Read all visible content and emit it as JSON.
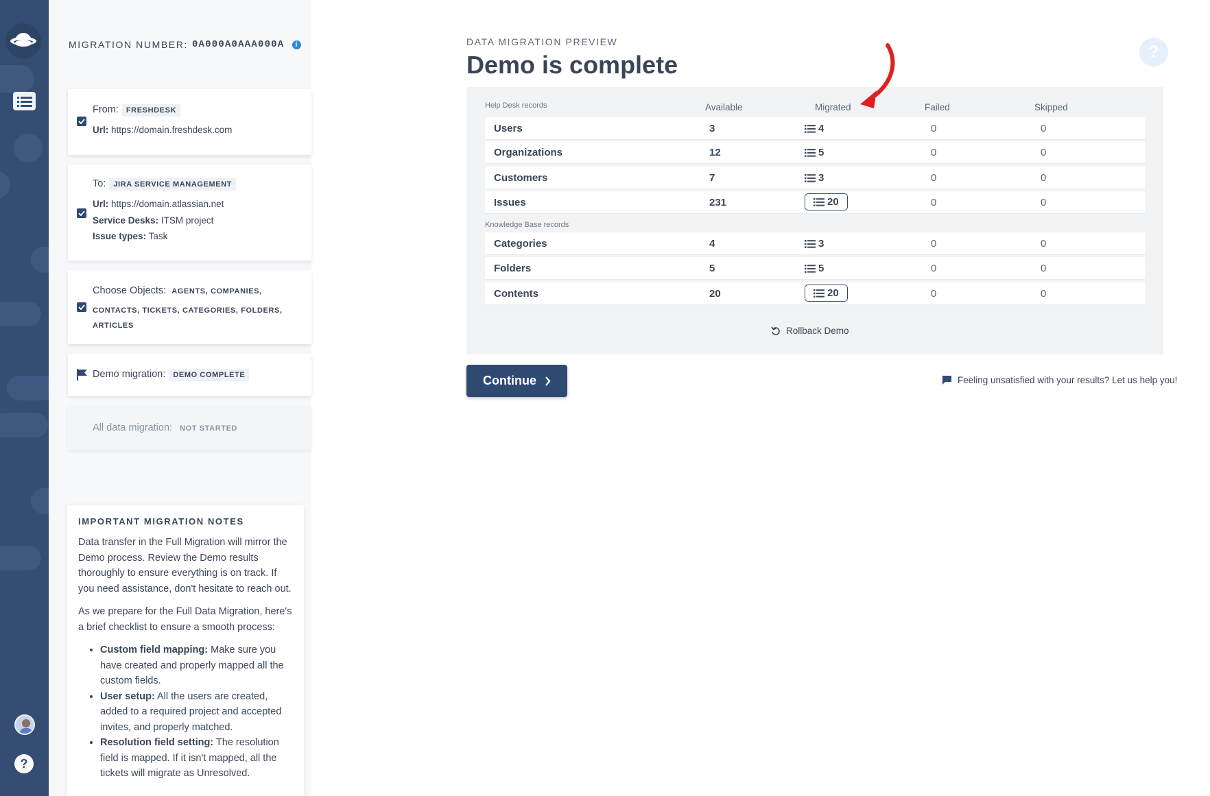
{
  "migration": {
    "label": "MIGRATION NUMBER:",
    "number": "0A000A0AAA000A",
    "info_icon": "info-icon"
  },
  "from": {
    "label": "From:",
    "tag": "FRESHDESK",
    "url_label": "Url:",
    "url": "https://domain.freshdesk.com"
  },
  "to": {
    "label": "To:",
    "tag": "JIRA SERVICE MANAGEMENT",
    "url_label": "Url:",
    "url": "https://domain.atlassian.net",
    "desks_label": "Service Desks:",
    "desks": "ITSM project",
    "types_label": "Issue types:",
    "types": "Task"
  },
  "objects": {
    "label": "Choose Objects:",
    "line1": "AGENTS, COMPANIES,",
    "line2": "CONTACTS, TICKETS, CATEGORIES, FOLDERS,",
    "line3": "ARTICLES"
  },
  "demo": {
    "label": "Demo migration:",
    "tag": "DEMO COMPLETE"
  },
  "full": {
    "label": "All data migration:",
    "tag": "NOT STARTED"
  },
  "notes": {
    "title": "IMPORTANT MIGRATION NOTES",
    "p1": "Data transfer in the Full Migration will mirror the Demo process. Review the Demo results thoroughly to ensure everything is on track. If you need assistance, don't hesitate to reach out.",
    "p2": "As we prepare for the Full Data Migration, here's a brief checklist to ensure a smooth process:",
    "items": [
      {
        "title": "Custom field mapping:",
        "text": " Make sure you have created and properly mapped all the custom fields."
      },
      {
        "title": "User setup:",
        "text": " All the users are created, added to a required project and accepted invites, and properly matched."
      },
      {
        "title": "Resolution field setting:",
        "text": " The resolution field is mapped. If it isn't mapped, all the tickets will migrate as Unresolved."
      }
    ]
  },
  "main": {
    "subtitle": "DATA MIGRATION PREVIEW",
    "title": "Demo is complete",
    "help_icon": "question-icon"
  },
  "table": {
    "headers": {
      "available": "Available",
      "migrated": "Migrated",
      "failed": "Failed",
      "skipped": "Skipped"
    },
    "groups": [
      {
        "label": "Help Desk records",
        "rows": [
          {
            "name": "Users",
            "available": "3",
            "migrated": "4",
            "failed": "0",
            "skipped": "0",
            "boxed": false
          },
          {
            "name": "Organizations",
            "available": "12",
            "migrated": "5",
            "failed": "0",
            "skipped": "0",
            "boxed": false
          },
          {
            "name": "Customers",
            "available": "7",
            "migrated": "3",
            "failed": "0",
            "skipped": "0",
            "boxed": false
          },
          {
            "name": "Issues",
            "available": "231",
            "migrated": "20",
            "failed": "0",
            "skipped": "0",
            "boxed": true
          }
        ]
      },
      {
        "label": "Knowledge Base records",
        "rows": [
          {
            "name": "Categories",
            "available": "4",
            "migrated": "3",
            "failed": "0",
            "skipped": "0",
            "boxed": false
          },
          {
            "name": "Folders",
            "available": "5",
            "migrated": "5",
            "failed": "0",
            "skipped": "0",
            "boxed": false
          },
          {
            "name": "Contents",
            "available": "20",
            "migrated": "20",
            "failed": "0",
            "skipped": "0",
            "boxed": true
          }
        ]
      }
    ],
    "rollback": "Rollback Demo"
  },
  "actions": {
    "continue": "Continue",
    "feedback": "Feeling unsatisfied with your results? Let us help you!"
  },
  "colors": {
    "rail": "#354d73",
    "primary": "#2f4a72",
    "arrow": "#e02020",
    "info": "#2f8ad8"
  },
  "icons": {
    "logo": "planet-logo-icon",
    "nav": "list-icon",
    "avatar": "avatar",
    "help": "question-icon",
    "flag": "flag-icon",
    "check": "checkbox-checked-icon",
    "rollback": "undo-icon",
    "chat": "chat-bubble-icon",
    "chevron": "chevron-right-icon"
  }
}
